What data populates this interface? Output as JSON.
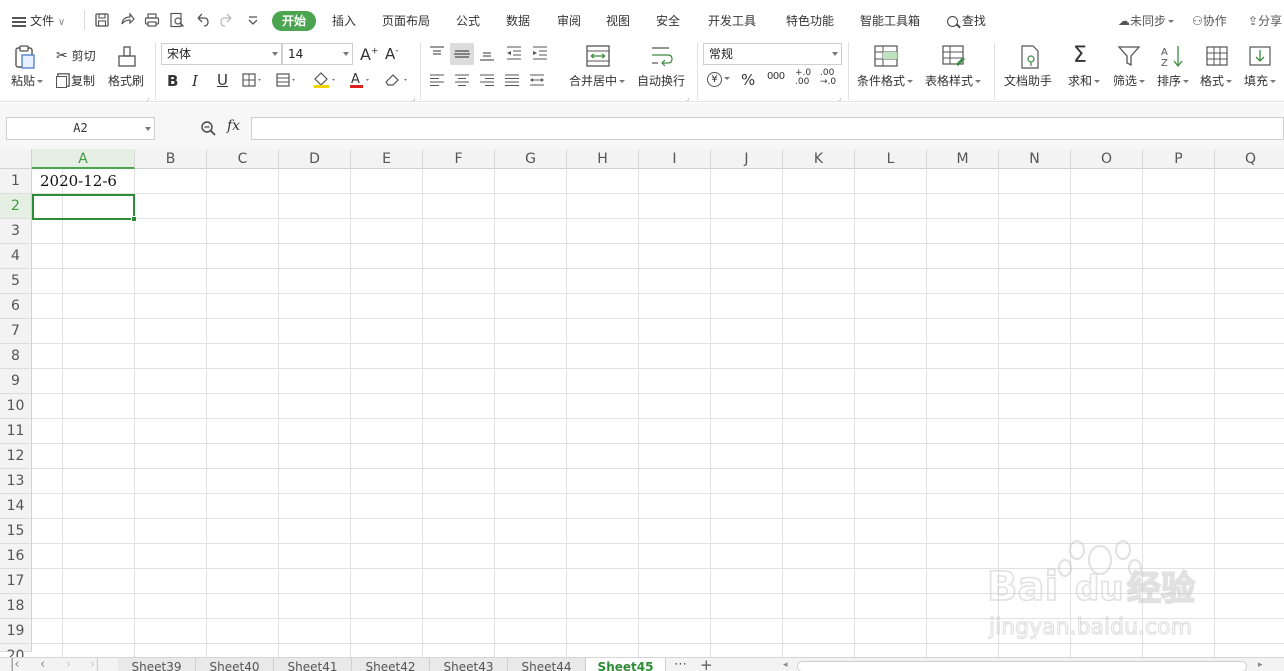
{
  "menubar": {
    "file": "文件",
    "tabs": [
      "开始",
      "插入",
      "页面布局",
      "公式",
      "数据",
      "审阅",
      "视图",
      "安全",
      "开发工具",
      "特色功能",
      "智能工具箱"
    ],
    "search": "查找",
    "sync": "未同步",
    "collab": "协作",
    "share": "分享"
  },
  "ribbon": {
    "paste": "粘贴",
    "cut": "剪切",
    "copy": "复制",
    "format_painter": "格式刷",
    "font_name": "宋体",
    "font_size": "14",
    "merge_center": "合并居中",
    "wrap": "自动换行",
    "number_format": "常规",
    "cond_format": "条件格式",
    "table_style": "表格样式",
    "doc_helper": "文档助手",
    "sum": "求和",
    "filter": "筛选",
    "sort": "排序",
    "format": "格式",
    "fill": "填充",
    "bold": "B",
    "italic": "I",
    "underline": "U",
    "font_color_glyph": "A",
    "percent": "%",
    "thousands": "000",
    "yen": "¥",
    "inc_dec": "+.0\n.00",
    "dec_dec": ".00\n→.0"
  },
  "formula_bar": {
    "name_box": "A2",
    "fx": "fx",
    "value": ""
  },
  "grid": {
    "columns": [
      "A",
      "B",
      "C",
      "D",
      "E",
      "F",
      "G",
      "H",
      "I",
      "J",
      "K",
      "L",
      "M",
      "N",
      "O",
      "P",
      "Q"
    ],
    "rows": [
      "1",
      "2",
      "3",
      "4",
      "5",
      "6",
      "7",
      "8",
      "9",
      "10",
      "11",
      "12",
      "13",
      "14",
      "15",
      "16",
      "17",
      "18",
      "19",
      "20"
    ],
    "selected_column": "A",
    "selected_row": "2",
    "cells": {
      "A1": "2020-12-6"
    }
  },
  "sheets": {
    "tabs": [
      "Sheet39",
      "Sheet40",
      "Sheet41",
      "Sheet42",
      "Sheet43",
      "Sheet44",
      "Sheet45"
    ],
    "active": "Sheet45",
    "more": "⋯",
    "add": "+"
  },
  "watermark": {
    "brand": "Bai",
    "brand2": "du",
    "brand3": "经验",
    "url": "jingyan.baidu.com"
  },
  "colors": {
    "accent": "#4aa450",
    "select": "#2e8b37"
  }
}
